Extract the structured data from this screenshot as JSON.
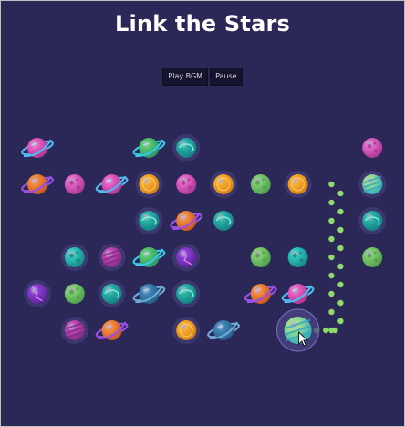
{
  "title": "Link the Stars",
  "controls": {
    "play_bgm_label": "Play BGM",
    "pause_label": "Pause"
  },
  "colors": {
    "background": "#2b2756",
    "title": "#ffffff",
    "button_bg": "#15132d",
    "button_text": "#d7d6e6",
    "path_dot": "#8fda6a",
    "halo": "#4b4684"
  },
  "board": {
    "rows": [
      [
        "pink-ringed",
        null,
        null,
        "teal-ringed",
        "cyan-swirl",
        null,
        null,
        null,
        null,
        "pink-swirl"
      ],
      [
        "orange-ringed",
        "pink-swirl",
        "pink-ringed",
        "orange-sun",
        "pink-swirl",
        "orange-sun",
        "green-dotted",
        "orange-sun",
        null,
        "green-striped"
      ],
      [
        null,
        null,
        null,
        "cyan-swirl",
        "orange-ringed",
        "cyan-swirl",
        null,
        null,
        null,
        "cyan-swirl"
      ],
      [
        null,
        "cyan-dotted",
        "magenta-striped",
        "teal-ringed",
        "purple-cracked",
        null,
        "green-dotted",
        "cyan-dotted",
        null,
        "green-dotted"
      ],
      [
        "purple-cracked",
        "green-dotted",
        "cyan-swirl",
        "blue-ringed",
        "cyan-swirl",
        null,
        "orange-ringed",
        "pink-ringed",
        null,
        null
      ],
      [
        null,
        "magenta-striped",
        "orange-ringed",
        null,
        "orange-sun",
        "blue-ringed",
        null,
        "green-striped",
        null,
        null
      ]
    ],
    "halo_tiles": [
      "0-4",
      "1-3",
      "1-5",
      "1-7",
      "1-9",
      "2-3",
      "2-9",
      "3-1",
      "3-2",
      "3-4",
      "4-0",
      "4-2",
      "4-4",
      "5-1",
      "5-4"
    ],
    "selected_tile": "5-7",
    "link_path": [
      "1-8",
      "5-8",
      "5-7"
    ]
  },
  "cursor": "arrow-cursor"
}
